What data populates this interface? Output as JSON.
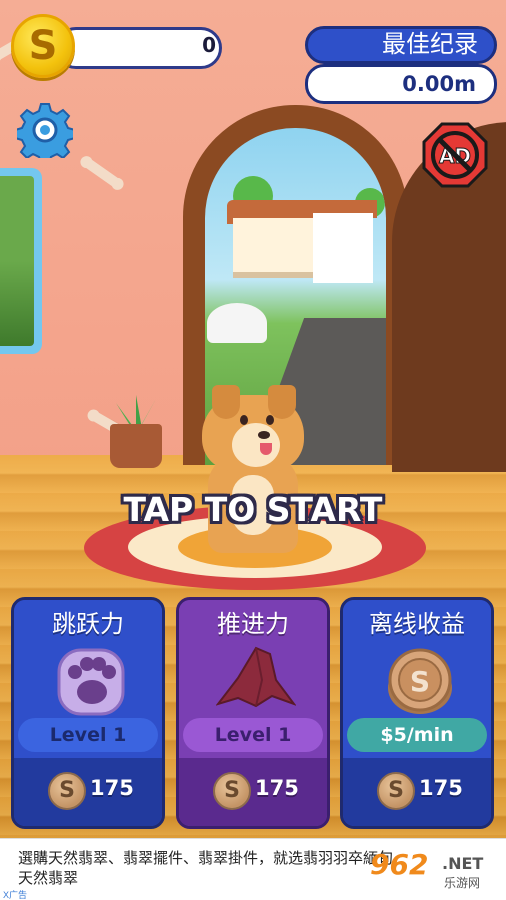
{
  "hud": {
    "coins": "0",
    "coin_symbol": "S",
    "record_title": "最佳纪录",
    "record_value": "0.00m",
    "ad_button_label": "AD"
  },
  "prompt": "TAP TO START",
  "upgrades": [
    {
      "title": "跳跃力",
      "icon": "paw-icon",
      "level": "Level 1",
      "cost": "175"
    },
    {
      "title": "推进力",
      "icon": "cape-icon",
      "level": "Level 1",
      "cost": "175"
    },
    {
      "title": "离线收益",
      "icon": "coin-icon",
      "level": "$5/min",
      "cost": "175"
    }
  ],
  "ad": {
    "text": "選購天然翡翠、翡翠擺件、翡翠掛件，就选翡羽羽卒緬甸天然翡翠",
    "mark": "X广告",
    "logo_num": "962",
    "logo_net": ".NET",
    "logo_sub": "乐游网"
  },
  "colors": {
    "accent_blue": "#2f4fca",
    "accent_purple": "#7a3fb3",
    "coin_gold": "#f3c20d",
    "rug_red": "#d64343"
  }
}
